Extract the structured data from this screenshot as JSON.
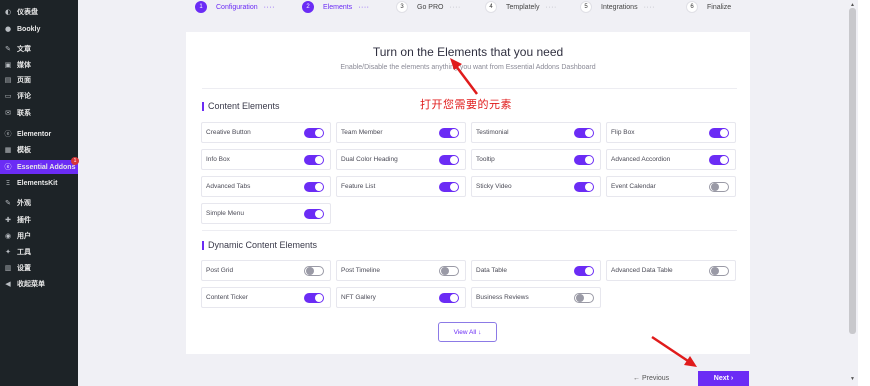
{
  "sidebar": {
    "items": [
      {
        "label": "仪表盘",
        "icon": "dashboard-icon"
      },
      {
        "label": "Bookly",
        "icon": "bookly-icon"
      },
      {
        "label": "文章",
        "icon": "pin-icon"
      },
      {
        "label": "媒体",
        "icon": "media-icon"
      },
      {
        "label": "页面",
        "icon": "page-icon"
      },
      {
        "label": "评论",
        "icon": "comment-icon"
      },
      {
        "label": "联系",
        "icon": "mail-icon"
      },
      {
        "label": "Elementor",
        "icon": "elementor-icon"
      },
      {
        "label": "模板",
        "icon": "folder-icon"
      },
      {
        "label": "Essential Addons",
        "icon": "essential-addons-icon",
        "badge": "1"
      },
      {
        "label": "ElementsKit",
        "icon": "elementskit-icon"
      },
      {
        "label": "外观",
        "icon": "brush-icon"
      },
      {
        "label": "插件",
        "icon": "plugin-icon"
      },
      {
        "label": "用户",
        "icon": "user-icon"
      },
      {
        "label": "工具",
        "icon": "wrench-icon"
      },
      {
        "label": "设置",
        "icon": "settings-icon"
      },
      {
        "label": "收起菜单",
        "icon": "collapse-icon"
      }
    ]
  },
  "steps": [
    {
      "num": "1",
      "label": "Configuration"
    },
    {
      "num": "2",
      "label": "Elements"
    },
    {
      "num": "3",
      "label": "Go PRO"
    },
    {
      "num": "4",
      "label": "Templately"
    },
    {
      "num": "5",
      "label": "Integrations"
    },
    {
      "num": "6",
      "label": "Finalize"
    }
  ],
  "panel": {
    "heading": "Turn on the Elements that you need",
    "subheading": "Enable/Disable the elements anything you want from Essential Addons Dashboard",
    "content_title": "Content Elements",
    "dynamic_title": "Dynamic Content Elements",
    "content_elements": [
      {
        "label": "Creative Button",
        "on": true
      },
      {
        "label": "Team Member",
        "on": true
      },
      {
        "label": "Testimonial",
        "on": true
      },
      {
        "label": "Flip Box",
        "on": true
      },
      {
        "label": "Info Box",
        "on": true
      },
      {
        "label": "Dual Color Heading",
        "on": true
      },
      {
        "label": "Tooltip",
        "on": true
      },
      {
        "label": "Advanced Accordion",
        "on": true
      },
      {
        "label": "Advanced Tabs",
        "on": true
      },
      {
        "label": "Feature List",
        "on": true
      },
      {
        "label": "Sticky Video",
        "on": true
      },
      {
        "label": "Event Calendar",
        "on": false
      },
      {
        "label": "Simple Menu",
        "on": true
      }
    ],
    "dynamic_elements": [
      {
        "label": "Post Grid",
        "on": false
      },
      {
        "label": "Post Timeline",
        "on": false
      },
      {
        "label": "Data Table",
        "on": true
      },
      {
        "label": "Advanced Data Table",
        "on": false
      },
      {
        "label": "Content Ticker",
        "on": true
      },
      {
        "label": "NFT Gallery",
        "on": true
      },
      {
        "label": "Business Reviews",
        "on": false
      }
    ],
    "view_all": "View All ↓"
  },
  "annotation": "打开您需要的元素",
  "nav": {
    "previous": "← Previous",
    "next": "Next ›"
  },
  "colors": {
    "accent": "#6b2cf5",
    "sidebar_bg": "#1d2327",
    "annotation": "#e01b1b"
  }
}
